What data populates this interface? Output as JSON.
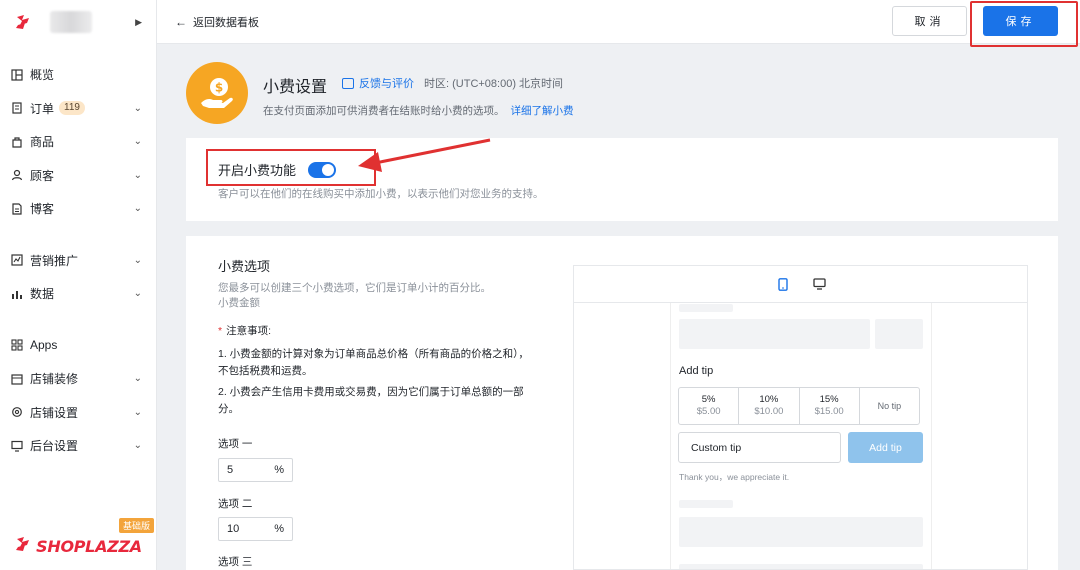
{
  "sidebar": {
    "items": [
      {
        "label": "概览",
        "icon": "overview-icon",
        "has_chevron": false
      },
      {
        "label": "订单",
        "icon": "order-icon",
        "badge": "119",
        "has_chevron": true
      },
      {
        "label": "商品",
        "icon": "product-icon",
        "has_chevron": true
      },
      {
        "label": "顾客",
        "icon": "customer-icon",
        "has_chevron": true
      },
      {
        "label": "博客",
        "icon": "blog-icon",
        "has_chevron": true
      },
      {
        "label": "营销推广",
        "icon": "marketing-icon",
        "has_chevron": true
      },
      {
        "label": "数据",
        "icon": "analytics-icon",
        "has_chevron": true
      },
      {
        "label": "Apps",
        "icon": "apps-icon",
        "has_chevron": false
      },
      {
        "label": "店铺装修",
        "icon": "store-design-icon",
        "has_chevron": true
      },
      {
        "label": "店铺设置",
        "icon": "store-settings-icon",
        "has_chevron": true
      },
      {
        "label": "后台设置",
        "icon": "admin-settings-icon",
        "has_chevron": true
      }
    ],
    "plan_tag": "基础版",
    "logo_text": "SHOPLAZZA"
  },
  "topbar": {
    "back_label": "返回数据看板",
    "cancel_label": "取消",
    "save_label": "保存"
  },
  "header": {
    "title": "小费设置",
    "feedback_label": "反馈与评价",
    "timezone": "时区: (UTC+08:00) 北京时间",
    "description": "在支付页面添加可供消费者在结账时给小费的选项。",
    "learn_more": "详细了解小费"
  },
  "tip_toggle": {
    "label": "开启小费功能",
    "enabled": true,
    "description": "客户可以在他们的在线购买中添加小费，以表示他们对您业务的支持。"
  },
  "tip_options": {
    "title": "小费选项",
    "desc_line1": "您最多可以创建三个小费选项，它们是订单小计的百分比。",
    "desc_line2": "小费金额",
    "note_title": "注意事项:",
    "note1_line1": "1. 小费金额的计算对象为订单商品总价格（所有商品的价格之和），",
    "note1_line2": "不包括税费和运费。",
    "note2_line1": "2. 小费会产生信用卡费用或交易费，因为它们属于订单总额的一部",
    "note2_line2": "分。",
    "options": [
      {
        "label": "选项 一",
        "value": "5",
        "unit": "%"
      },
      {
        "label": "选项 二",
        "value": "10",
        "unit": "%"
      },
      {
        "label": "选项 三"
      }
    ]
  },
  "preview": {
    "add_tip_title": "Add tip",
    "tips": [
      {
        "percent": "5%",
        "amount": "$5.00"
      },
      {
        "percent": "10%",
        "amount": "$10.00"
      },
      {
        "percent": "15%",
        "amount": "$15.00"
      }
    ],
    "no_tip": "No tip",
    "custom_placeholder": "Custom tip",
    "add_button": "Add tip",
    "thanks": "Thank you，we appreciate it."
  },
  "colors": {
    "primary": "#1a73e8",
    "annotation_red": "#e03131",
    "brand_red": "#e8283c",
    "tip_icon_bg": "#f6a623"
  }
}
